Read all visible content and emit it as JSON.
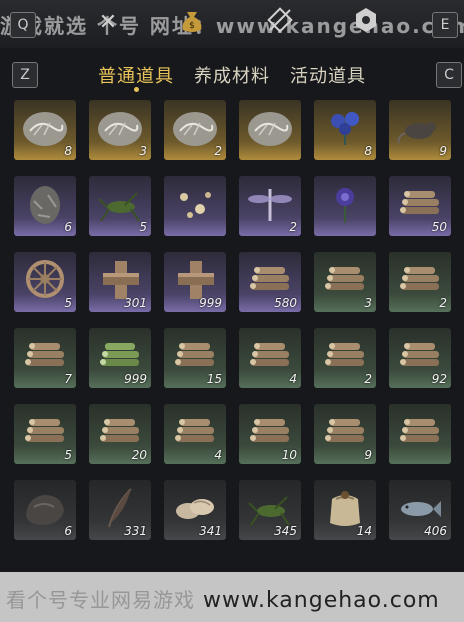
{
  "topbar": {
    "watermark": "游戏就选 个号 网址：www.kangehao.com",
    "left_key": "Q",
    "right_key": "E"
  },
  "tabs": {
    "left_key": "Z",
    "right_key": "C",
    "items": [
      {
        "label": "普通道具",
        "active": true
      },
      {
        "label": "养成材料",
        "active": false
      },
      {
        "label": "活动道具",
        "active": false
      }
    ]
  },
  "inventory": [
    {
      "icon": "fossil-stone-icon",
      "count": "8",
      "rarity": "gold"
    },
    {
      "icon": "fossil-stone-icon",
      "count": "3",
      "rarity": "gold"
    },
    {
      "icon": "fossil-stone-icon",
      "count": "2",
      "rarity": "gold"
    },
    {
      "icon": "fossil-stone-icon",
      "count": "",
      "rarity": "gold"
    },
    {
      "icon": "blue-flower-icon",
      "count": "8",
      "rarity": "gold"
    },
    {
      "icon": "rat-icon",
      "count": "9",
      "rarity": "gold"
    },
    {
      "icon": "egg-stone-icon",
      "count": "6",
      "rarity": "purple"
    },
    {
      "icon": "cricket-icon",
      "count": "5",
      "rarity": "purple"
    },
    {
      "icon": "fireflies-icon",
      "count": "",
      "rarity": "purple"
    },
    {
      "icon": "dragonfly-icon",
      "count": "2",
      "rarity": "purple"
    },
    {
      "icon": "purple-flower-icon",
      "count": "",
      "rarity": "purple"
    },
    {
      "icon": "log-pile-icon",
      "count": "50",
      "rarity": "purple"
    },
    {
      "icon": "wheel-icon",
      "count": "5",
      "rarity": "purple"
    },
    {
      "icon": "wood-block-icon",
      "count": "301",
      "rarity": "purple"
    },
    {
      "icon": "wood-block-icon",
      "count": "999",
      "rarity": "purple"
    },
    {
      "icon": "log-pile-icon",
      "count": "580",
      "rarity": "purple"
    },
    {
      "icon": "log-pile-icon",
      "count": "3",
      "rarity": "green"
    },
    {
      "icon": "log-pile-icon",
      "count": "2",
      "rarity": "green"
    },
    {
      "icon": "log-pile-icon",
      "count": "7",
      "rarity": "green"
    },
    {
      "icon": "bamboo-pile-icon",
      "count": "999",
      "rarity": "green"
    },
    {
      "icon": "log-pile-icon",
      "count": "15",
      "rarity": "green"
    },
    {
      "icon": "log-pile-icon",
      "count": "4",
      "rarity": "green"
    },
    {
      "icon": "log-pile-icon",
      "count": "2",
      "rarity": "green"
    },
    {
      "icon": "log-pile-icon",
      "count": "92",
      "rarity": "green"
    },
    {
      "icon": "log-pile-icon",
      "count": "5",
      "rarity": "green"
    },
    {
      "icon": "log-pile-icon",
      "count": "20",
      "rarity": "green"
    },
    {
      "icon": "log-pile-icon",
      "count": "4",
      "rarity": "green"
    },
    {
      "icon": "log-pile-icon",
      "count": "10",
      "rarity": "green"
    },
    {
      "icon": "log-pile-icon",
      "count": "9",
      "rarity": "green"
    },
    {
      "icon": "log-pile-icon",
      "count": "",
      "rarity": "green"
    },
    {
      "icon": "rock-icon",
      "count": "6",
      "rarity": "gray"
    },
    {
      "icon": "feather-icon",
      "count": "331",
      "rarity": "gray"
    },
    {
      "icon": "shell-icon",
      "count": "341",
      "rarity": "gray"
    },
    {
      "icon": "cricket-icon",
      "count": "345",
      "rarity": "gray"
    },
    {
      "icon": "grain-sack-icon",
      "count": "14",
      "rarity": "gray"
    },
    {
      "icon": "fish-icon",
      "count": "406",
      "rarity": "gray"
    }
  ],
  "watermark_bottom": {
    "cn": "看个号专业网易游戏",
    "url": "www.kangehao.com"
  }
}
